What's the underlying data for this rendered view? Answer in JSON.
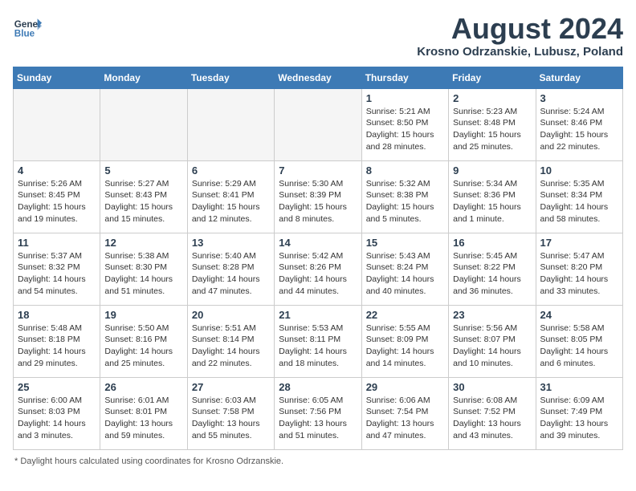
{
  "header": {
    "logo_line1": "General",
    "logo_line2": "Blue",
    "month_year": "August 2024",
    "location": "Krosno Odrzanskie, Lubusz, Poland"
  },
  "columns": [
    "Sunday",
    "Monday",
    "Tuesday",
    "Wednesday",
    "Thursday",
    "Friday",
    "Saturday"
  ],
  "footer_note": "Daylight hours",
  "weeks": [
    [
      {
        "day": "",
        "info": ""
      },
      {
        "day": "",
        "info": ""
      },
      {
        "day": "",
        "info": ""
      },
      {
        "day": "",
        "info": ""
      },
      {
        "day": "1",
        "info": "Sunrise: 5:21 AM\nSunset: 8:50 PM\nDaylight: 15 hours\nand 28 minutes."
      },
      {
        "day": "2",
        "info": "Sunrise: 5:23 AM\nSunset: 8:48 PM\nDaylight: 15 hours\nand 25 minutes."
      },
      {
        "day": "3",
        "info": "Sunrise: 5:24 AM\nSunset: 8:46 PM\nDaylight: 15 hours\nand 22 minutes."
      }
    ],
    [
      {
        "day": "4",
        "info": "Sunrise: 5:26 AM\nSunset: 8:45 PM\nDaylight: 15 hours\nand 19 minutes."
      },
      {
        "day": "5",
        "info": "Sunrise: 5:27 AM\nSunset: 8:43 PM\nDaylight: 15 hours\nand 15 minutes."
      },
      {
        "day": "6",
        "info": "Sunrise: 5:29 AM\nSunset: 8:41 PM\nDaylight: 15 hours\nand 12 minutes."
      },
      {
        "day": "7",
        "info": "Sunrise: 5:30 AM\nSunset: 8:39 PM\nDaylight: 15 hours\nand 8 minutes."
      },
      {
        "day": "8",
        "info": "Sunrise: 5:32 AM\nSunset: 8:38 PM\nDaylight: 15 hours\nand 5 minutes."
      },
      {
        "day": "9",
        "info": "Sunrise: 5:34 AM\nSunset: 8:36 PM\nDaylight: 15 hours\nand 1 minute."
      },
      {
        "day": "10",
        "info": "Sunrise: 5:35 AM\nSunset: 8:34 PM\nDaylight: 14 hours\nand 58 minutes."
      }
    ],
    [
      {
        "day": "11",
        "info": "Sunrise: 5:37 AM\nSunset: 8:32 PM\nDaylight: 14 hours\nand 54 minutes."
      },
      {
        "day": "12",
        "info": "Sunrise: 5:38 AM\nSunset: 8:30 PM\nDaylight: 14 hours\nand 51 minutes."
      },
      {
        "day": "13",
        "info": "Sunrise: 5:40 AM\nSunset: 8:28 PM\nDaylight: 14 hours\nand 47 minutes."
      },
      {
        "day": "14",
        "info": "Sunrise: 5:42 AM\nSunset: 8:26 PM\nDaylight: 14 hours\nand 44 minutes."
      },
      {
        "day": "15",
        "info": "Sunrise: 5:43 AM\nSunset: 8:24 PM\nDaylight: 14 hours\nand 40 minutes."
      },
      {
        "day": "16",
        "info": "Sunrise: 5:45 AM\nSunset: 8:22 PM\nDaylight: 14 hours\nand 36 minutes."
      },
      {
        "day": "17",
        "info": "Sunrise: 5:47 AM\nSunset: 8:20 PM\nDaylight: 14 hours\nand 33 minutes."
      }
    ],
    [
      {
        "day": "18",
        "info": "Sunrise: 5:48 AM\nSunset: 8:18 PM\nDaylight: 14 hours\nand 29 minutes."
      },
      {
        "day": "19",
        "info": "Sunrise: 5:50 AM\nSunset: 8:16 PM\nDaylight: 14 hours\nand 25 minutes."
      },
      {
        "day": "20",
        "info": "Sunrise: 5:51 AM\nSunset: 8:14 PM\nDaylight: 14 hours\nand 22 minutes."
      },
      {
        "day": "21",
        "info": "Sunrise: 5:53 AM\nSunset: 8:11 PM\nDaylight: 14 hours\nand 18 minutes."
      },
      {
        "day": "22",
        "info": "Sunrise: 5:55 AM\nSunset: 8:09 PM\nDaylight: 14 hours\nand 14 minutes."
      },
      {
        "day": "23",
        "info": "Sunrise: 5:56 AM\nSunset: 8:07 PM\nDaylight: 14 hours\nand 10 minutes."
      },
      {
        "day": "24",
        "info": "Sunrise: 5:58 AM\nSunset: 8:05 PM\nDaylight: 14 hours\nand 6 minutes."
      }
    ],
    [
      {
        "day": "25",
        "info": "Sunrise: 6:00 AM\nSunset: 8:03 PM\nDaylight: 14 hours\nand 3 minutes."
      },
      {
        "day": "26",
        "info": "Sunrise: 6:01 AM\nSunset: 8:01 PM\nDaylight: 13 hours\nand 59 minutes."
      },
      {
        "day": "27",
        "info": "Sunrise: 6:03 AM\nSunset: 7:58 PM\nDaylight: 13 hours\nand 55 minutes."
      },
      {
        "day": "28",
        "info": "Sunrise: 6:05 AM\nSunset: 7:56 PM\nDaylight: 13 hours\nand 51 minutes."
      },
      {
        "day": "29",
        "info": "Sunrise: 6:06 AM\nSunset: 7:54 PM\nDaylight: 13 hours\nand 47 minutes."
      },
      {
        "day": "30",
        "info": "Sunrise: 6:08 AM\nSunset: 7:52 PM\nDaylight: 13 hours\nand 43 minutes."
      },
      {
        "day": "31",
        "info": "Sunrise: 6:09 AM\nSunset: 7:49 PM\nDaylight: 13 hours\nand 39 minutes."
      }
    ]
  ]
}
